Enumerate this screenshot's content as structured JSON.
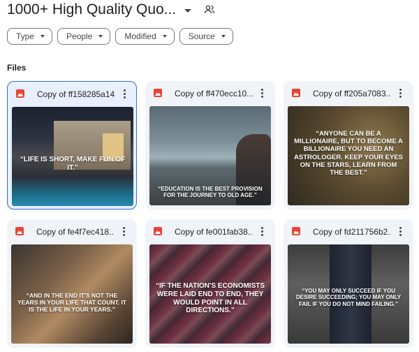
{
  "header": {
    "title": "1000+ High Quality Quo...",
    "dropdown_icon": "caret-down-icon",
    "shared_icon": "people-icon"
  },
  "filters": [
    {
      "label": "Type"
    },
    {
      "label": "People"
    },
    {
      "label": "Modified"
    },
    {
      "label": "Source"
    }
  ],
  "section_label": "Files",
  "files": [
    {
      "name": "Copy of ff158285a14...",
      "icon": "pdf-icon",
      "quote": "“LIFE IS SHORT, MAKE FUN OF IT.”",
      "selected": true
    },
    {
      "name": "Copy of ff470ecc10...",
      "icon": "pdf-icon",
      "quote": "“EDUCATION IS THE BEST PROVISION FOR THE JOURNEY TO OLD AGE.”"
    },
    {
      "name": "Copy of ff205a7083...",
      "icon": "pdf-icon",
      "quote": "“ANYONE CAN BE A MILLIONAIRE, BUT TO BECOME A BILLIONAIRE YOU NEED AN ASTROLOGER. KEEP YOUR EYES ON THE STARS, LEARN FROM THE BEST.”"
    },
    {
      "name": "Copy of fe4f7ec418...",
      "icon": "pdf-icon",
      "quote": "“AND IN THE END IT'S NOT THE YEARS IN YOUR LIFE THAT COUNT. IT IS THE LIFE IN YOUR YEARS.”"
    },
    {
      "name": "Copy of fe001fab38...",
      "icon": "pdf-icon",
      "quote": "“IF THE NATION'S ECONOMISTS WERE LAID END TO END, THEY WOULD POINT IN ALL DIRECTIONS.”"
    },
    {
      "name": "Copy of fd211756b2...",
      "icon": "pdf-icon",
      "quote": "“YOU MAY ONLY SUCCEED IF YOU DESIRE SUCCEEDING; YOU MAY ONLY FAIL IF YOU DO NOT MIND FAILING.”"
    }
  ],
  "colors": {
    "accent": "#2f6bd6",
    "pdf": "#ea4335",
    "card_bg": "#f0f4f9"
  }
}
